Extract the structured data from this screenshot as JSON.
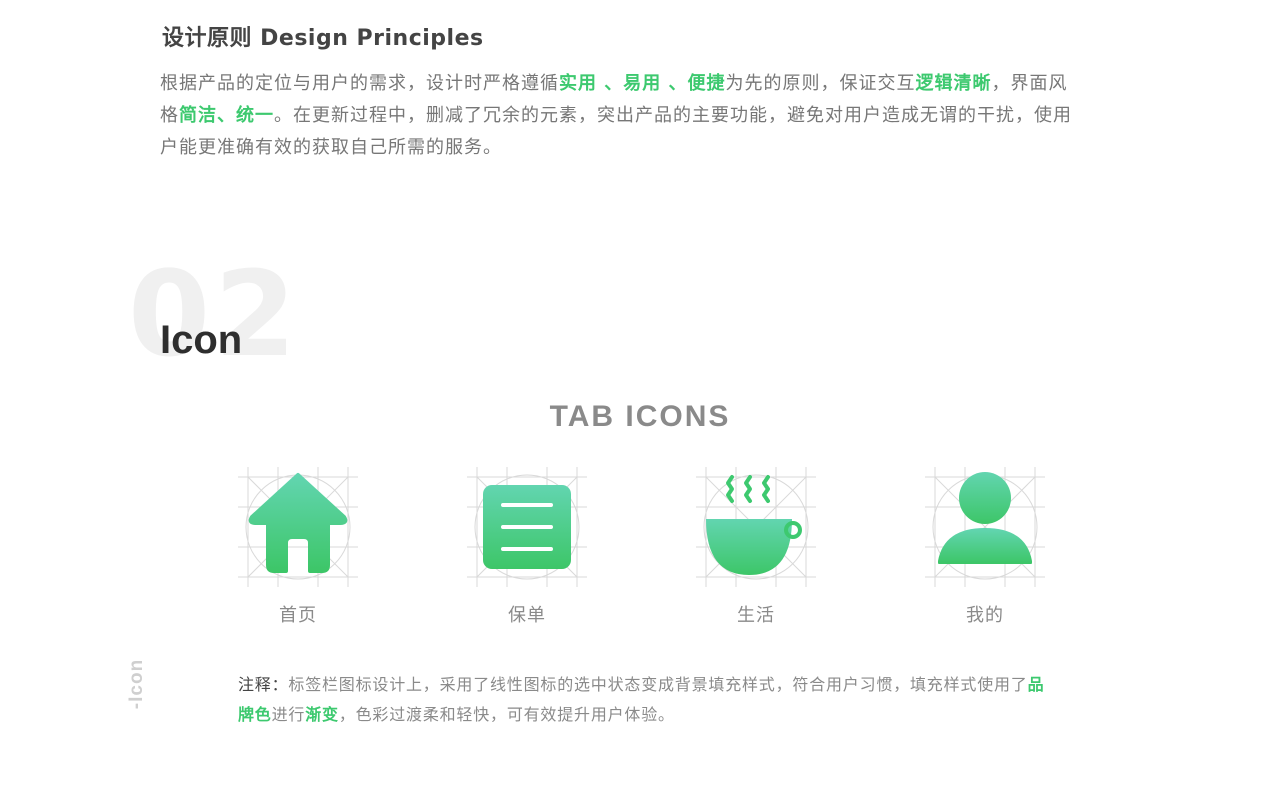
{
  "principles": {
    "title": "设计原则 Design Principles",
    "body": [
      {
        "text": "根据产品的定位与用户的需求，设计时严格遵循",
        "highlight": false
      },
      {
        "text": "实用 、易用 、便捷",
        "highlight": true
      },
      {
        "text": "为先的原则，保证交互",
        "highlight": false
      },
      {
        "text": "逻辑清晰",
        "highlight": true
      },
      {
        "text": "，界面风格",
        "highlight": false
      },
      {
        "text": "简洁、统一",
        "highlight": true
      },
      {
        "text": "。在更新过程中，删减了冗余的元素，突出产品的主要功能，避免对用户造成无谓的干扰，使用户能更准确有效的获取自己所需的服务。",
        "highlight": false
      }
    ]
  },
  "section": {
    "number": "02",
    "title": "Icon",
    "side_label": "-Icon"
  },
  "tab_icons": {
    "heading": "TAB ICONS",
    "items": [
      {
        "label": "首页",
        "icon": "home-icon"
      },
      {
        "label": "保单",
        "icon": "policy-list-icon"
      },
      {
        "label": "生活",
        "icon": "coffee-cup-icon"
      },
      {
        "label": "我的",
        "icon": "user-profile-icon"
      }
    ]
  },
  "note": {
    "label": "注释：",
    "parts": [
      {
        "text": "标签栏图标设计上，采用了线性图标的选中状态变成背景填充样式，符合用户习惯，填充样式使用了",
        "highlight": false
      },
      {
        "text": "品牌色",
        "highlight": true
      },
      {
        "text": "进行",
        "highlight": false
      },
      {
        "text": "渐变",
        "highlight": true
      },
      {
        "text": "，色彩过渡柔和轻快，可有效提升用户体验。",
        "highlight": false
      }
    ]
  },
  "colors": {
    "brand_green": "#3dc96f",
    "gradient_top": "#62d5b0",
    "gradient_bottom": "#3dc668"
  }
}
